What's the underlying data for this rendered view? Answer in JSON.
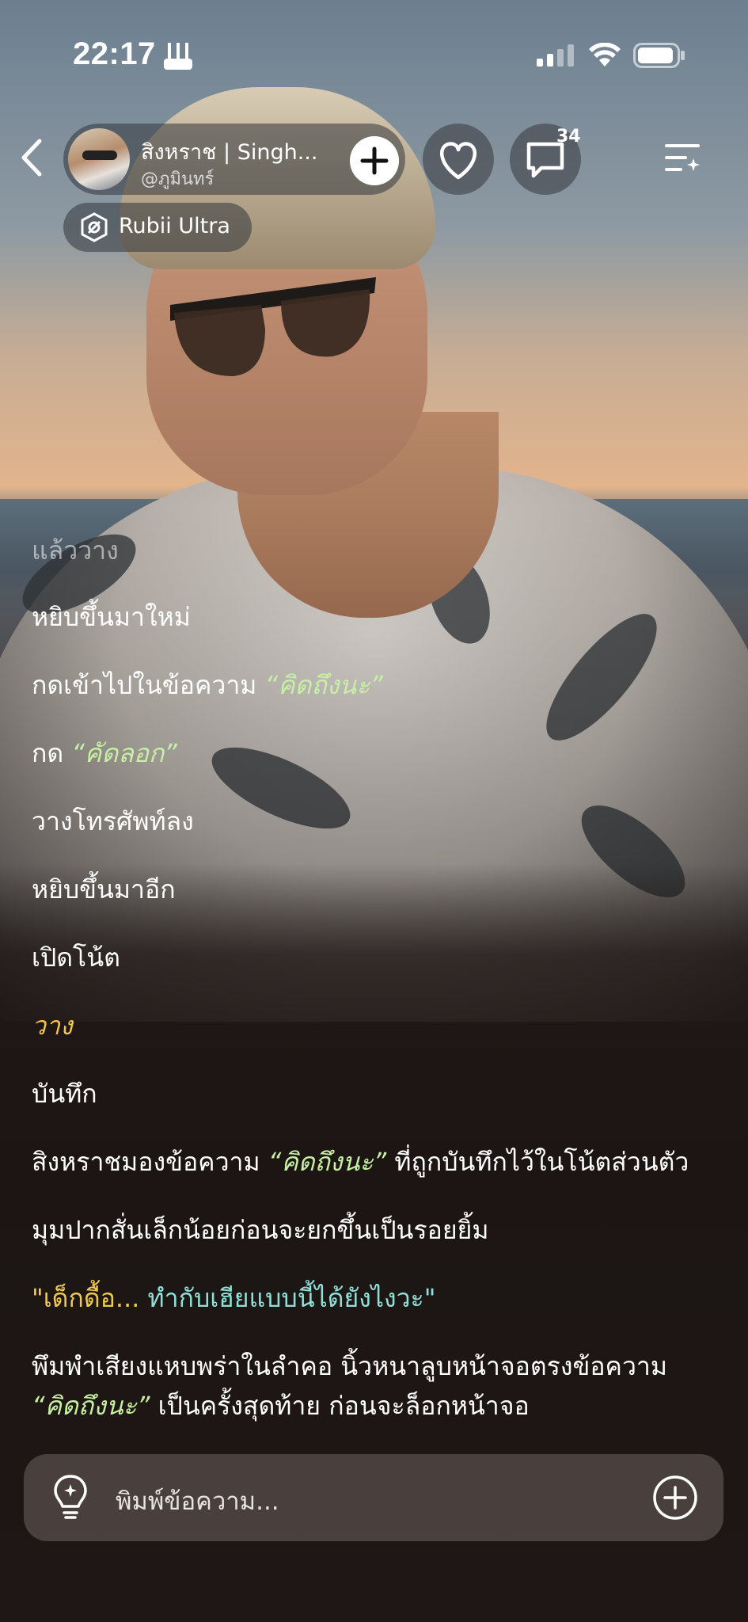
{
  "status_bar": {
    "time": "22:17",
    "time_icon": "game-controller-icon",
    "signal": "signal-icon",
    "wifi": "wifi-icon",
    "battery": "battery-icon"
  },
  "header": {
    "character_name": "สิงหราช | Singh...",
    "creator_handle": "@ภูมินทร์",
    "comment_count": "34",
    "model_label": "Rubii Ultra",
    "icons": {
      "back": "chevron-left-icon",
      "add": "plus-icon",
      "like": "heart-icon",
      "comment": "comment-icon",
      "menu": "menu-sparkle-icon",
      "model": "model-badge-icon"
    }
  },
  "messages": [
    {
      "text": "แล้ววาง",
      "style": "faded"
    },
    {
      "text": "หยิบขึ้นมาใหม่"
    },
    {
      "text": "กดเข้าไปในข้อความ ",
      "quote": "“คิดถึงนะ”"
    },
    {
      "text": "กด ",
      "quote": "“คัดลอก”"
    },
    {
      "text": "วางโทรศัพท์ลง"
    },
    {
      "text": "หยิบขึ้นมาอีก"
    },
    {
      "text": "เปิดโน้ต"
    },
    {
      "text": "วาง",
      "style": "gold"
    },
    {
      "text": "บันทึก"
    },
    {
      "text": "สิงหราชมองข้อความ ",
      "quote": "“คิดถึงนะ”",
      "suffix": " ที่ถูกบันทึกไว้ในโน้ตส่วนตัว"
    },
    {
      "text": "มุมปากสั่นเล็กน้อยก่อนจะยกขึ้นเป็นรอยยิ้ม"
    },
    {
      "speech_a": "\"เด็กดื้อ... ",
      "speech_b": "ทำกับเฮียแบบนี้ได้ยังไงวะ\""
    },
    {
      "text": "พึมพำเสียงแหบพร่าในลำคอ นิ้วหนาลูบหน้าจอตรงข้อความ"
    },
    {
      "quote": "“คิดถึงนะ”",
      "suffix": " เป็นครั้งสุดท้าย ก่อนจะล็อกหน้าจอ"
    }
  ],
  "composer": {
    "placeholder": "พิมพ์ข้อความ...",
    "left_icon": "lightbulb-sparkle-icon",
    "right_icon": "plus-circle-icon"
  },
  "colors": {
    "quote_green": "#c6f0a3",
    "quote_cyan": "#8fe0d8",
    "gold": "#f3c64a",
    "pill_bg": "#32373c"
  }
}
